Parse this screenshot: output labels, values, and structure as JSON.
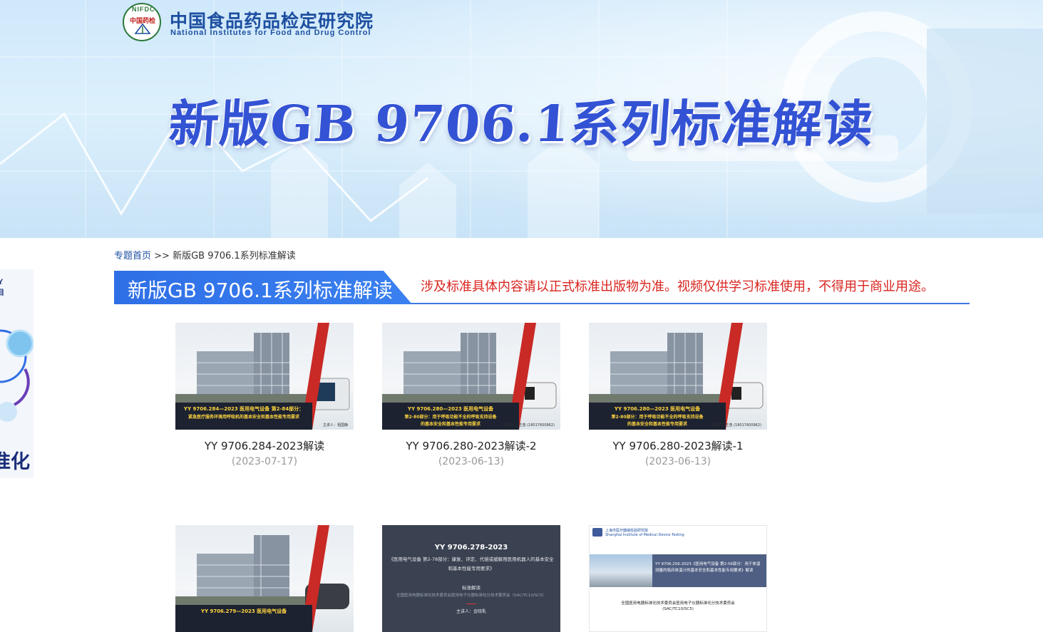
{
  "header": {
    "logo_badge_top": "NIFDC",
    "logo_badge_mid": "中国药检",
    "org_name_cn": "中国食品药品检定研究院",
    "org_name_en": "National Institutes for Food and Drug Control",
    "banner_title": "新版GB 9706.1系列标准解读"
  },
  "side_ad": {
    "line1": "Y",
    "line2": "目",
    "line3": "准化"
  },
  "breadcrumb": {
    "home": "专题首页",
    "separator": ">>",
    "current": "新版GB 9706.1系列标准解读"
  },
  "section": {
    "title": "新版GB 9706.1系列标准解读",
    "notice": "涉及标准具体内容请以正式标准出版物为准。视频仅供学习标准使用，不得用于商业用途。"
  },
  "colors": {
    "accent_blue": "#3b78e0",
    "notice_red": "#d8241e",
    "banner_title_blue": "#3353d4"
  },
  "videos": [
    {
      "title": "YY 9706.284-2023解读",
      "date": "(2023-07-17)",
      "thumb": {
        "line1": "YY 9706.284—2023 医用电气设备 第2-84部分：",
        "line2": "紧急医疗服务环境用呼吸机的基本安全和基本性能专用要求",
        "line3": "",
        "speaker": "主讲人：祖国静"
      }
    },
    {
      "title": "YY 9706.280-2023解读-2",
      "date": "(2023-06-13)",
      "thumb": {
        "line1": "YY 9706.280—2023 医用电气设备",
        "line2": "第2-80部分：用于呼吸功能不全的呼吸支持设备",
        "line3": "的基本安全和基本性能专用要求",
        "speaker": "主讲人：王逸 (18017600962)"
      }
    },
    {
      "title": "YY 9706.280-2023解读-1",
      "date": "(2023-06-13)",
      "thumb": {
        "line1": "YY 9706.280—2023 医用电气设备",
        "line2": "第2-80部分：用于呼吸功能不全的呼吸支持设备",
        "line3": "的基本安全和基本性能专用要求",
        "speaker": "主讲人：王逸 (18017600962)"
      }
    },
    {
      "title": "",
      "date": "",
      "thumb": {
        "line1": "YY 9706.279—2023 医用电气设备",
        "line2": "",
        "line3": "",
        "speaker": ""
      }
    },
    {
      "title": "",
      "date": "",
      "thumb": {
        "d1": "YY 9706.278-2023",
        "d2": "《医用电气设备 第2-78部分：康复、评定、代偿或缓解用医用机器人的基本安全和基本性能专用要求》",
        "d3": "标准解读",
        "d4": "全国医用电器标准化技术委员会医用电子仪器标准化分技术委员会（SAC/TC10/SC5）",
        "d5": "主讲人：金晓乳"
      }
    },
    {
      "title": "",
      "date": "",
      "thumb": {
        "hdr1": "上海市医疗器械检验研究院",
        "hdr2": "Shanghai Institute of Medical Device Testing",
        "band": "YY 9706.256-2023《医用电气设备 第2-56部分：用于体温测量的临床体温计的基本安全和基本性能专用要求》解读",
        "f1": "全国医用电器标准化技术委员会医用电子仪器标准化分技术委员会",
        "f2": "(SAC/TC10/SC5)"
      }
    }
  ]
}
